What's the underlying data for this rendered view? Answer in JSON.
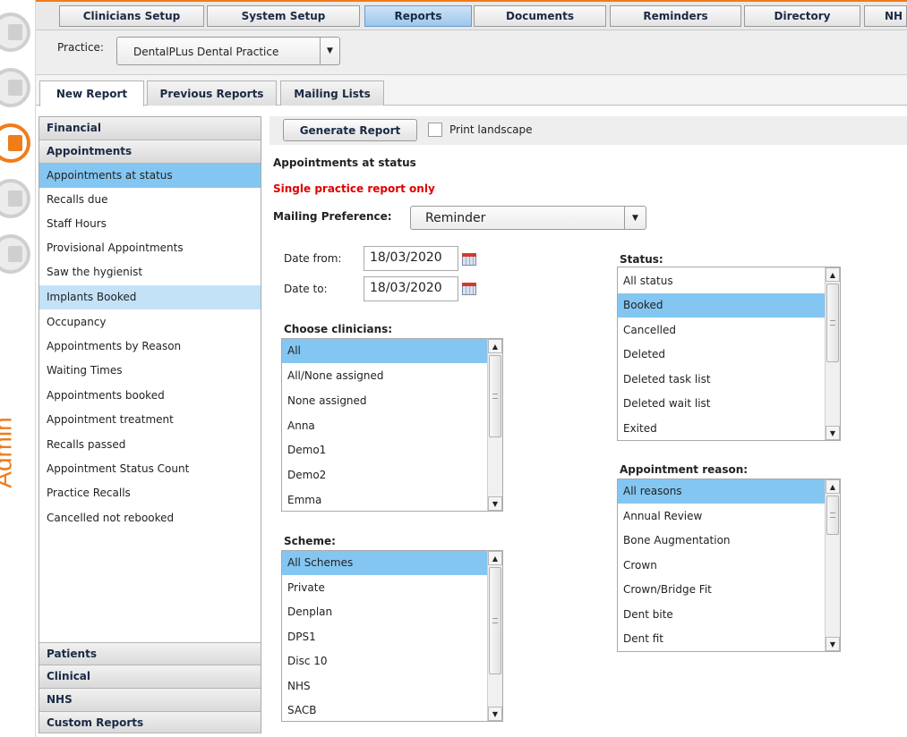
{
  "rail": {
    "label": "Admin",
    "icons": [
      "person-icon",
      "calendar-icon",
      "reports-icon",
      "phone-icon",
      "power-icon"
    ]
  },
  "topnav": {
    "items": [
      {
        "label": "Clinicians Setup",
        "active": false
      },
      {
        "label": "System Setup",
        "active": false
      },
      {
        "label": "Reports",
        "active": true
      },
      {
        "label": "Documents",
        "active": false
      },
      {
        "label": "Reminders",
        "active": false
      },
      {
        "label": "Directory",
        "active": false
      },
      {
        "label": "NH",
        "active": false
      }
    ]
  },
  "practice": {
    "label": "Practice:",
    "value": "DentalPLus Dental Practice"
  },
  "subtabs": [
    {
      "label": "New Report",
      "active": true
    },
    {
      "label": "Previous Reports",
      "active": false
    },
    {
      "label": "Mailing Lists",
      "active": false
    }
  ],
  "report_panel": {
    "categories_top": [
      "Financial",
      "Appointments"
    ],
    "items": [
      "Appointments at status",
      "Recalls due",
      "Staff Hours",
      "Provisional Appointments",
      "Saw the hygienist",
      "Implants Booked",
      "Occupancy",
      "Appointments by Reason",
      "Waiting Times",
      "Appointments booked",
      "Appointment treatment",
      "Recalls passed",
      "Appointment Status Count",
      "Practice Recalls",
      "Cancelled not rebooked"
    ],
    "categories_bottom": [
      "Patients",
      "Clinical",
      "NHS",
      "Custom Reports"
    ]
  },
  "toolbar": {
    "generate_label": "Generate Report",
    "landscape_label": "Print landscape"
  },
  "report": {
    "title": "Appointments at status",
    "warning": "Single practice report only",
    "mailing_label": "Mailing Preference:",
    "mailing_value": "Reminder",
    "date_from_label": "Date from:",
    "date_from": "18/03/2020",
    "date_to_label": "Date to:",
    "date_to": "18/03/2020",
    "clinicians_label": "Choose clinicians:",
    "clinicians": [
      "All",
      "All/None assigned",
      "None assigned",
      "Anna",
      "Demo1",
      "Demo2",
      "Emma"
    ],
    "scheme_label": "Scheme:",
    "schemes": [
      "All Schemes",
      "Private",
      "Denplan",
      "DPS1",
      "Disc 10",
      "NHS",
      "SACB"
    ],
    "status_label": "Status:",
    "statuses": [
      "All status",
      "Booked",
      "Cancelled",
      "Deleted",
      "Deleted task list",
      "Deleted wait list",
      "Exited"
    ],
    "reason_label": "Appointment reason:",
    "reasons": [
      "All reasons",
      "Annual Review",
      "Bone Augmentation",
      "Crown",
      "Crown/Bridge Fit",
      "Dent bite",
      "Dent fit"
    ]
  },
  "colors": {
    "accent": "#f07c1a",
    "selection": "#84c6f2",
    "highlight": "#c3e2f8",
    "warning": "#e00000"
  }
}
